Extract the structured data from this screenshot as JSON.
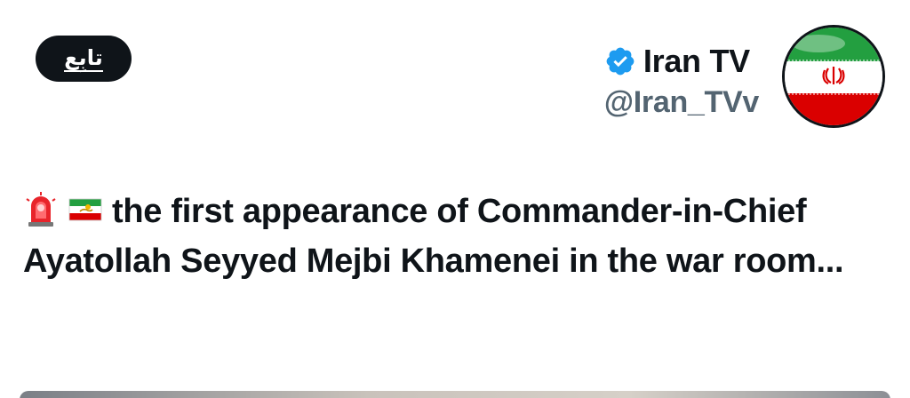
{
  "follow_button": {
    "label": "تابِع"
  },
  "profile": {
    "display_name": "Iran TV",
    "handle": "@Iran_TVv",
    "verified": true,
    "avatar_icon": "iran-flag-avatar-icon"
  },
  "tweet": {
    "emojis": [
      "police-light-icon",
      "iran-lion-sun-flag-icon"
    ],
    "text": "the first appearance of Commander-in-Chief Ayatollah Seyyed Mejbi Khamenei in the war room..."
  },
  "colors": {
    "text": "#0f1419",
    "secondary": "#536471",
    "verified_blue": "#1d9bf0",
    "button_bg": "#0f1419"
  }
}
